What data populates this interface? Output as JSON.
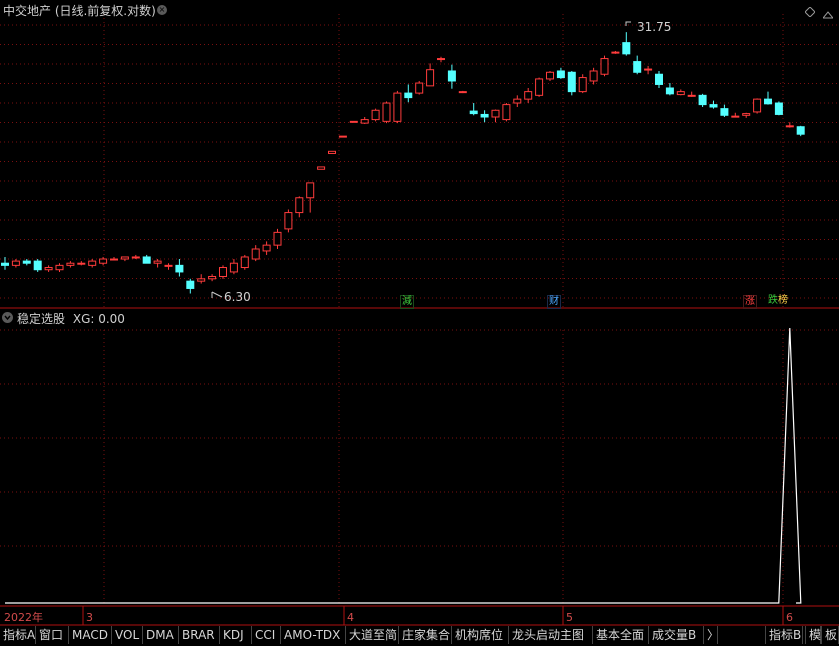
{
  "header": {
    "title": "中交地产 (日线.前复权.对数)",
    "close_icon": "close-circle-icon",
    "diamond_icon": "diamond-icon",
    "minimize_icon": "collapse-icon"
  },
  "price_chart": {
    "high_label": "31.75",
    "low_label": "6.30",
    "event_tags": [
      {
        "text": "減",
        "color": "#3cc83c"
      },
      {
        "text": "财",
        "color": "#4aa8ff"
      },
      {
        "text": "涨",
        "color": "#ff4040"
      },
      {
        "text": "跌",
        "color": "#3cc83c"
      },
      {
        "text": "榜",
        "color": "#ffd24a"
      }
    ]
  },
  "indicator": {
    "name": "稳定选股",
    "value_label": "XG: 0.00"
  },
  "date_axis": {
    "labels": [
      "2022年",
      "3",
      "4",
      "5",
      "6"
    ]
  },
  "tabs": [
    "指标A",
    "窗口",
    "MACD",
    "VOL",
    "DMA",
    "BRAR",
    "KDJ",
    "CCI",
    "AMO-TDX",
    "大道至简",
    "庄家集合",
    "机构席位",
    "龙头启动主图",
    "基本全面",
    "成交量B",
    "〉"
  ],
  "tabs_right": [
    "指标B",
    "模",
    "板"
  ],
  "colors": {
    "up": "#ff3c3c",
    "down": "#54ffff",
    "grid": "#7a1010",
    "axis": "#b01010",
    "line": "#ffffff"
  },
  "chart_data": {
    "type": "candlestick",
    "candles": [
      [
        7.6,
        7.9,
        7.3,
        7.5
      ],
      [
        7.5,
        7.8,
        7.4,
        7.7
      ],
      [
        7.7,
        7.8,
        7.5,
        7.6
      ],
      [
        7.7,
        7.8,
        7.2,
        7.3
      ],
      [
        7.3,
        7.5,
        7.2,
        7.4
      ],
      [
        7.3,
        7.6,
        7.2,
        7.5
      ],
      [
        7.5,
        7.7,
        7.4,
        7.6
      ],
      [
        7.6,
        7.7,
        7.5,
        7.6
      ],
      [
        7.5,
        7.8,
        7.4,
        7.7
      ],
      [
        7.6,
        7.9,
        7.5,
        7.8
      ],
      [
        7.8,
        7.9,
        7.8,
        7.8
      ],
      [
        7.8,
        7.9,
        7.7,
        7.9
      ],
      [
        7.9,
        8.0,
        7.8,
        7.9
      ],
      [
        7.9,
        8.0,
        7.6,
        7.6
      ],
      [
        7.6,
        7.8,
        7.4,
        7.7
      ],
      [
        7.5,
        7.6,
        7.3,
        7.5
      ],
      [
        7.5,
        7.8,
        7.0,
        7.2
      ],
      [
        6.8,
        6.9,
        6.3,
        6.5
      ],
      [
        6.8,
        7.1,
        6.7,
        6.9
      ],
      [
        6.9,
        7.1,
        6.8,
        7.0
      ],
      [
        7.0,
        7.5,
        6.9,
        7.4
      ],
      [
        7.2,
        7.8,
        7.1,
        7.6
      ],
      [
        7.4,
        8.0,
        7.3,
        7.9
      ],
      [
        7.8,
        8.5,
        7.7,
        8.3
      ],
      [
        8.2,
        8.7,
        8.0,
        8.5
      ],
      [
        8.5,
        9.4,
        8.3,
        9.2
      ],
      [
        9.4,
        10.6,
        9.2,
        10.4
      ],
      [
        10.4,
        11.5,
        10.1,
        11.4
      ],
      [
        11.4,
        12.5,
        10.4,
        12.5
      ],
      [
        13.6,
        13.8,
        13.6,
        13.8
      ],
      [
        15.0,
        15.2,
        15.0,
        15.2
      ],
      [
        16.7,
        16.7,
        16.7,
        16.7
      ],
      [
        18.3,
        18.3,
        18.3,
        18.3
      ],
      [
        18.1,
        18.8,
        18.0,
        18.5
      ],
      [
        18.5,
        19.8,
        18.3,
        19.6
      ],
      [
        18.3,
        20.7,
        18.1,
        20.5
      ],
      [
        18.3,
        22.1,
        18.1,
        21.8
      ],
      [
        21.8,
        23.0,
        20.6,
        21.2
      ],
      [
        21.8,
        23.5,
        21.6,
        23.2
      ],
      [
        22.8,
        26.2,
        22.8,
        25.2
      ],
      [
        27.0,
        27.3,
        26.4,
        27.0
      ],
      [
        25.0,
        26.0,
        22.4,
        23.5
      ],
      [
        22.0,
        22.1,
        21.8,
        22.0
      ],
      [
        19.5,
        20.5,
        19.0,
        19.2
      ],
      [
        19.1,
        19.6,
        18.2,
        18.8
      ],
      [
        18.8,
        19.7,
        18.2,
        19.6
      ],
      [
        18.5,
        20.5,
        18.3,
        20.3
      ],
      [
        20.5,
        21.5,
        20.0,
        21.0
      ],
      [
        21.0,
        22.5,
        20.5,
        22.0
      ],
      [
        21.5,
        24.0,
        21.3,
        23.8
      ],
      [
        23.8,
        25.0,
        23.5,
        24.8
      ],
      [
        25.0,
        25.5,
        23.8,
        24.0
      ],
      [
        24.8,
        25.0,
        21.5,
        22.0
      ],
      [
        22.0,
        24.5,
        21.8,
        24.0
      ],
      [
        23.5,
        25.5,
        23.0,
        25.0
      ],
      [
        24.5,
        27.5,
        24.2,
        27.0
      ],
      [
        28.0,
        28.3,
        27.8,
        28.1
      ],
      [
        29.8,
        31.8,
        27.5,
        27.8
      ],
      [
        26.5,
        27.5,
        24.5,
        24.8
      ],
      [
        25.2,
        25.8,
        24.5,
        25.3
      ],
      [
        24.5,
        25.0,
        22.5,
        23.0
      ],
      [
        22.5,
        23.2,
        21.5,
        21.7
      ],
      [
        21.6,
        22.3,
        21.5,
        22.0
      ],
      [
        21.5,
        22.0,
        21.3,
        21.5
      ],
      [
        21.5,
        21.7,
        20.0,
        20.3
      ],
      [
        20.3,
        20.8,
        19.8,
        20.0
      ],
      [
        19.8,
        20.3,
        18.8,
        19.0
      ],
      [
        18.9,
        19.3,
        18.8,
        18.9
      ],
      [
        19.0,
        19.3,
        18.7,
        19.2
      ],
      [
        19.4,
        21.1,
        19.2,
        21.0
      ],
      [
        21.0,
        22.0,
        20.3,
        20.4
      ],
      [
        20.5,
        20.7,
        19.0,
        19.1
      ],
      [
        17.8,
        18.2,
        17.6,
        17.8
      ],
      [
        17.7,
        17.8,
        16.7,
        16.9
      ]
    ],
    "indicator_series": {
      "name": "XG",
      "peak_index": 72,
      "peak_value": 1,
      "values_note_free": [
        0,
        1,
        0
      ]
    }
  }
}
